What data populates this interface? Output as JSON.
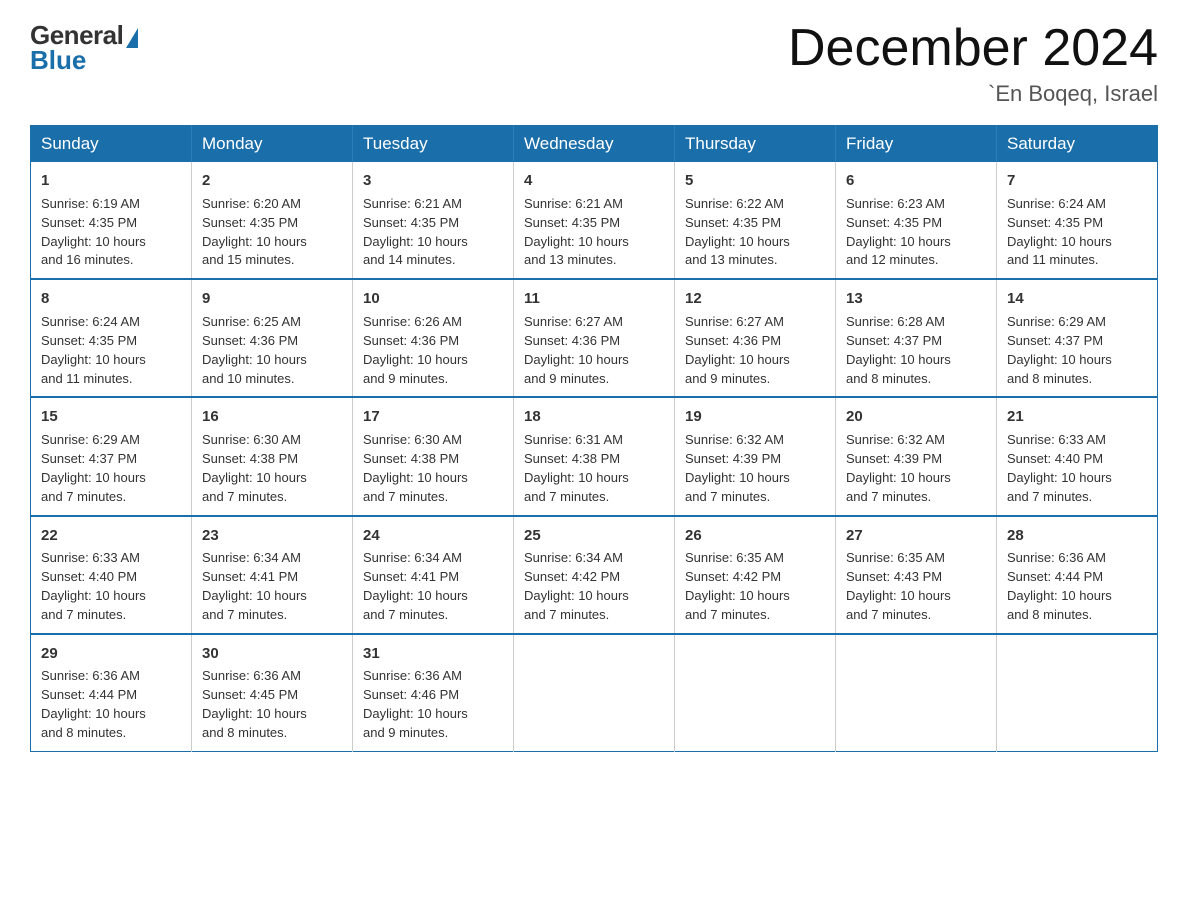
{
  "logo": {
    "general": "General",
    "blue": "Blue"
  },
  "header": {
    "month": "December 2024",
    "location": "`En Boqeq, Israel"
  },
  "weekdays": [
    "Sunday",
    "Monday",
    "Tuesday",
    "Wednesday",
    "Thursday",
    "Friday",
    "Saturday"
  ],
  "weeks": [
    [
      {
        "day": "1",
        "sunrise": "6:19 AM",
        "sunset": "4:35 PM",
        "daylight": "10 hours and 16 minutes."
      },
      {
        "day": "2",
        "sunrise": "6:20 AM",
        "sunset": "4:35 PM",
        "daylight": "10 hours and 15 minutes."
      },
      {
        "day": "3",
        "sunrise": "6:21 AM",
        "sunset": "4:35 PM",
        "daylight": "10 hours and 14 minutes."
      },
      {
        "day": "4",
        "sunrise": "6:21 AM",
        "sunset": "4:35 PM",
        "daylight": "10 hours and 13 minutes."
      },
      {
        "day": "5",
        "sunrise": "6:22 AM",
        "sunset": "4:35 PM",
        "daylight": "10 hours and 13 minutes."
      },
      {
        "day": "6",
        "sunrise": "6:23 AM",
        "sunset": "4:35 PM",
        "daylight": "10 hours and 12 minutes."
      },
      {
        "day": "7",
        "sunrise": "6:24 AM",
        "sunset": "4:35 PM",
        "daylight": "10 hours and 11 minutes."
      }
    ],
    [
      {
        "day": "8",
        "sunrise": "6:24 AM",
        "sunset": "4:35 PM",
        "daylight": "10 hours and 11 minutes."
      },
      {
        "day": "9",
        "sunrise": "6:25 AM",
        "sunset": "4:36 PM",
        "daylight": "10 hours and 10 minutes."
      },
      {
        "day": "10",
        "sunrise": "6:26 AM",
        "sunset": "4:36 PM",
        "daylight": "10 hours and 9 minutes."
      },
      {
        "day": "11",
        "sunrise": "6:27 AM",
        "sunset": "4:36 PM",
        "daylight": "10 hours and 9 minutes."
      },
      {
        "day": "12",
        "sunrise": "6:27 AM",
        "sunset": "4:36 PM",
        "daylight": "10 hours and 9 minutes."
      },
      {
        "day": "13",
        "sunrise": "6:28 AM",
        "sunset": "4:37 PM",
        "daylight": "10 hours and 8 minutes."
      },
      {
        "day": "14",
        "sunrise": "6:29 AM",
        "sunset": "4:37 PM",
        "daylight": "10 hours and 8 minutes."
      }
    ],
    [
      {
        "day": "15",
        "sunrise": "6:29 AM",
        "sunset": "4:37 PM",
        "daylight": "10 hours and 7 minutes."
      },
      {
        "day": "16",
        "sunrise": "6:30 AM",
        "sunset": "4:38 PM",
        "daylight": "10 hours and 7 minutes."
      },
      {
        "day": "17",
        "sunrise": "6:30 AM",
        "sunset": "4:38 PM",
        "daylight": "10 hours and 7 minutes."
      },
      {
        "day": "18",
        "sunrise": "6:31 AM",
        "sunset": "4:38 PM",
        "daylight": "10 hours and 7 minutes."
      },
      {
        "day": "19",
        "sunrise": "6:32 AM",
        "sunset": "4:39 PM",
        "daylight": "10 hours and 7 minutes."
      },
      {
        "day": "20",
        "sunrise": "6:32 AM",
        "sunset": "4:39 PM",
        "daylight": "10 hours and 7 minutes."
      },
      {
        "day": "21",
        "sunrise": "6:33 AM",
        "sunset": "4:40 PM",
        "daylight": "10 hours and 7 minutes."
      }
    ],
    [
      {
        "day": "22",
        "sunrise": "6:33 AM",
        "sunset": "4:40 PM",
        "daylight": "10 hours and 7 minutes."
      },
      {
        "day": "23",
        "sunrise": "6:34 AM",
        "sunset": "4:41 PM",
        "daylight": "10 hours and 7 minutes."
      },
      {
        "day": "24",
        "sunrise": "6:34 AM",
        "sunset": "4:41 PM",
        "daylight": "10 hours and 7 minutes."
      },
      {
        "day": "25",
        "sunrise": "6:34 AM",
        "sunset": "4:42 PM",
        "daylight": "10 hours and 7 minutes."
      },
      {
        "day": "26",
        "sunrise": "6:35 AM",
        "sunset": "4:42 PM",
        "daylight": "10 hours and 7 minutes."
      },
      {
        "day": "27",
        "sunrise": "6:35 AM",
        "sunset": "4:43 PM",
        "daylight": "10 hours and 7 minutes."
      },
      {
        "day": "28",
        "sunrise": "6:36 AM",
        "sunset": "4:44 PM",
        "daylight": "10 hours and 8 minutes."
      }
    ],
    [
      {
        "day": "29",
        "sunrise": "6:36 AM",
        "sunset": "4:44 PM",
        "daylight": "10 hours and 8 minutes."
      },
      {
        "day": "30",
        "sunrise": "6:36 AM",
        "sunset": "4:45 PM",
        "daylight": "10 hours and 8 minutes."
      },
      {
        "day": "31",
        "sunrise": "6:36 AM",
        "sunset": "4:46 PM",
        "daylight": "10 hours and 9 minutes."
      },
      null,
      null,
      null,
      null
    ]
  ]
}
